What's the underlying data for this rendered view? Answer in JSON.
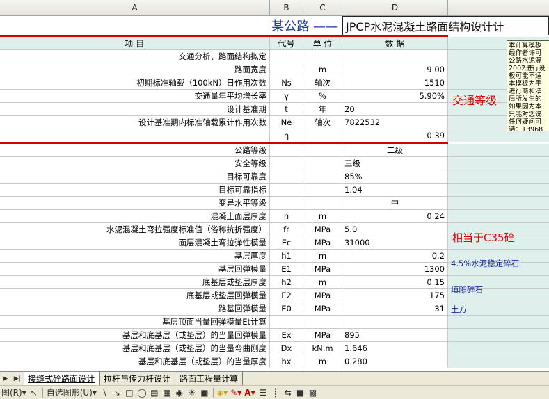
{
  "columns": [
    "A",
    "B",
    "C",
    "D"
  ],
  "title": {
    "road_name": "某公路 ——",
    "main_title": "JPCP水泥混凝土路面结构设计计"
  },
  "header": {
    "item": "项                    目",
    "code": "代号",
    "unit": "单 位",
    "data": "数    据"
  },
  "rows": [
    {
      "label": "交通分析、路面结构拟定",
      "code": "",
      "unit": "",
      "value": "",
      "align": "left"
    },
    {
      "label": "路面宽度",
      "code": "",
      "unit": "m",
      "value": "9.00",
      "align": "right"
    },
    {
      "label": "初期标准轴载（100kN）日作用次数",
      "code": "Ns",
      "unit": "轴次",
      "value": "1510",
      "align": "right"
    },
    {
      "label": "交通量年平均增长率",
      "code": "γ",
      "unit": "%",
      "value": "5.90%",
      "align": "right"
    },
    {
      "label": "设计基准期",
      "code": "t",
      "unit": "年",
      "value": "20",
      "align": "left"
    },
    {
      "label": "设计基准期内标准轴载累计作用次数",
      "code": "Ne",
      "unit": "轴次",
      "value": "7822532",
      "align": "left"
    },
    {
      "label": "",
      "code": "η",
      "unit": "",
      "value": "0.39",
      "align": "right"
    },
    {
      "label": "公路等级",
      "code": "",
      "unit": "",
      "value": "二级",
      "align": "center"
    },
    {
      "label": "安全等级",
      "code": "",
      "unit": "",
      "value": "三级",
      "align": "left"
    },
    {
      "label": "目标可靠度",
      "code": "",
      "unit": "",
      "value": "85%",
      "align": "left"
    },
    {
      "label": "目标可靠指标",
      "code": "",
      "unit": "",
      "value": "1.04",
      "align": "left"
    },
    {
      "label": "变异水平等级",
      "code": "",
      "unit": "",
      "value": "中",
      "align": "center"
    },
    {
      "label": "混凝土面层厚度",
      "code": "h",
      "unit": "m",
      "value": "0.24",
      "align": "right"
    },
    {
      "label": "水泥混凝土弯拉强度标准值（俗称抗折强度）",
      "code": "fr",
      "unit": "MPa",
      "value": "5.0",
      "align": "left"
    },
    {
      "label": "面层混凝土弯拉弹性模量",
      "code": "Ec",
      "unit": "MPa",
      "value": "31000",
      "align": "left"
    },
    {
      "label": "基层厚度",
      "code": "h1",
      "unit": "m",
      "value": "0.2",
      "align": "right"
    },
    {
      "label": "基层回弹模量",
      "code": "E1",
      "unit": "MPa",
      "value": "1300",
      "align": "right"
    },
    {
      "label": "底基层或垫层厚度",
      "code": "h2",
      "unit": "m",
      "value": "0.15",
      "align": "right"
    },
    {
      "label": "底基层或垫层回弹模量",
      "code": "E2",
      "unit": "MPa",
      "value": "175",
      "align": "right"
    },
    {
      "label": "路基回弹模量",
      "code": "E0",
      "unit": "MPa",
      "value": "31",
      "align": "right"
    },
    {
      "label": "基层顶面当量回弹模量Et计算",
      "code": "",
      "unit": "",
      "value": "",
      "align": "left"
    },
    {
      "label": "基层和底基层（或垫层）的当量回弹模量",
      "code": "Ex",
      "unit": "MPa",
      "value": "895",
      "align": "left"
    },
    {
      "label": "基层和底基层（或垫层）的当量弯曲刚度",
      "code": "Dx",
      "unit": "kN.m",
      "value": "1.646",
      "align": "left"
    },
    {
      "label": "基层和底基层（或垫层）的当量厚度",
      "code": "hx",
      "unit": "m",
      "value": "0.280",
      "align": "left"
    }
  ],
  "side_notes": {
    "traffic_grade": "交通等级",
    "concrete_equiv": "相当于C35砼",
    "base_material": "4.5%水泥稳定碎石",
    "subbase_material": "填隙碎石",
    "subgrade_material": "土方"
  },
  "comment_lines": [
    "本计算模板",
    "经作者许可",
    "公路水泥混",
    "2002进行设",
    "板可能不适",
    "本模板为手",
    "进行商和法",
    "后所发生的",
    "如果因为本",
    "只能对您说",
    "任何疑问可",
    "话：13968"
  ],
  "tabs": [
    {
      "label": "接缝式砼路面设计",
      "active": true
    },
    {
      "label": "拉杆与传力杆设计",
      "active": false
    },
    {
      "label": "路面工程量计算",
      "active": false
    }
  ],
  "drawbar": {
    "draw_label": "图(R)",
    "autoshape_label": "自选图形(U)"
  }
}
